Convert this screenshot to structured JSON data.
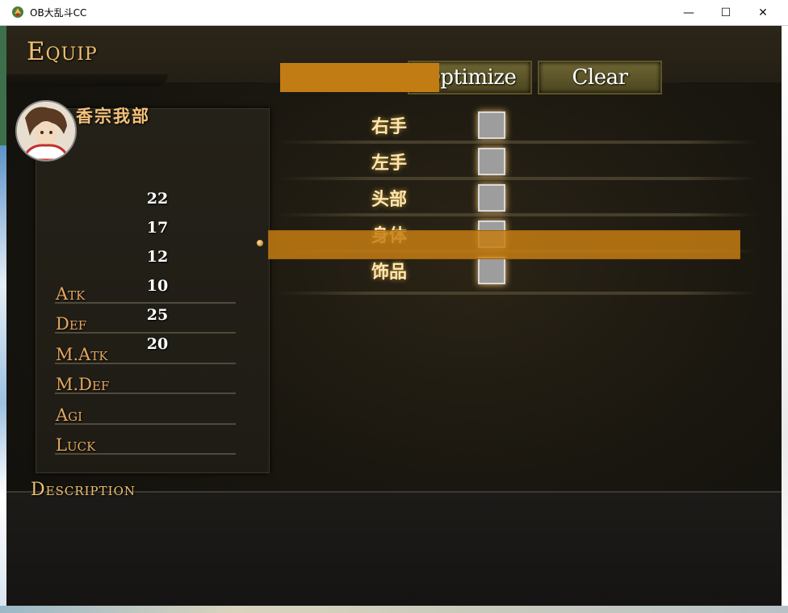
{
  "window": {
    "title": "OB大乱斗CC",
    "minimize_glyph": "—",
    "maximize_glyph": "☐",
    "close_glyph": "✕"
  },
  "scene": {
    "title": "Equip"
  },
  "toolbar": {
    "optimize_label": "Optimize",
    "clear_label": "Clear"
  },
  "actor": {
    "name": "香宗我部",
    "stats": [
      {
        "label": "Atk"
      },
      {
        "label": "Def"
      },
      {
        "label": "M.Atk"
      },
      {
        "label": "M.Def"
      },
      {
        "label": "Agi"
      },
      {
        "label": "Luck"
      }
    ],
    "values": [
      "22",
      "17",
      "12",
      "10",
      "25",
      "20"
    ]
  },
  "slots": [
    {
      "label": "右手"
    },
    {
      "label": "左手"
    },
    {
      "label": "头部"
    },
    {
      "label": "身体"
    },
    {
      "label": "饰品"
    }
  ],
  "description": {
    "title": "Description",
    "text": ""
  },
  "colors": {
    "accent": "#c27c14",
    "title_gold": "#f0c070"
  }
}
